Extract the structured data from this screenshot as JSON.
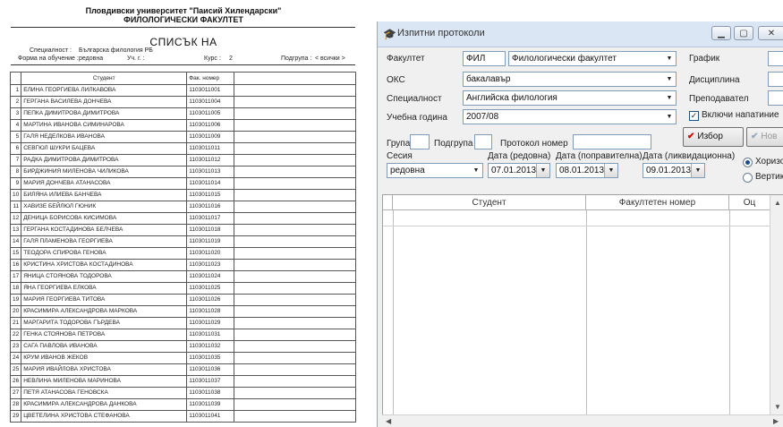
{
  "document": {
    "university": "Пловдивски университет \"Паисий Хилендарски\"",
    "faculty": "ФИЛОЛОГИЧЕСКИ ФАКУЛТЕТ",
    "title": "СПИСЪК НА",
    "specialty_label": "Специалност :",
    "specialty_value": "Българска филология РБ",
    "study_form_label": "Форма на обучение :",
    "study_form_value": "редовна",
    "year_label": "Уч. г. :",
    "course_label": "Курс :",
    "course_value": "2",
    "subgroup_label": "Подгрупа :",
    "subgroup_value": "< всички >",
    "col_student": "Студент",
    "col_fac_no": "Фак. номер",
    "rows": [
      {
        "no": "1",
        "name": "ЕЛИНА ГЕОРГИЕВА ЛИЛКАВОВА",
        "fac": "1103011001"
      },
      {
        "no": "2",
        "name": "ГЕРГАНА ВАСИЛЕВА ДОНЧЕВА",
        "fac": "1103011004"
      },
      {
        "no": "3",
        "name": "ПЕПКА ДИМИТРОВА ДИМИТРОВА",
        "fac": "1103011005"
      },
      {
        "no": "4",
        "name": "МАРТИНА ИВАНОВА СИМИНАРОВА",
        "fac": "1103011006"
      },
      {
        "no": "5",
        "name": "ГАЛЯ НЕДЕЛКОВА ИВАНОВА",
        "fac": "1103011009"
      },
      {
        "no": "6",
        "name": "СЕВГЮЛ ШУКРИ БАЦЕВА",
        "fac": "1103011011"
      },
      {
        "no": "7",
        "name": "РАДКА ДИМИТРОВА ДИМИТРОВА",
        "fac": "1103011012"
      },
      {
        "no": "8",
        "name": "БИРДЖИНИЯ МИЛЕНОВА ЧИЛИКОВА",
        "fac": "1103011013"
      },
      {
        "no": "9",
        "name": "МАРИЯ ДОНЧЕВА АТАНАСОВА",
        "fac": "1103011014"
      },
      {
        "no": "10",
        "name": "БИЛЯНА ИЛИЕВА БАНЧЕВА",
        "fac": "1103011015"
      },
      {
        "no": "11",
        "name": "ХАВИЗЕ БЕЙЛЮЛ ГЮНИК",
        "fac": "1103011016"
      },
      {
        "no": "12",
        "name": "ДЕНИЦА БОРИСОВА КИСИМОВА",
        "fac": "1103011017"
      },
      {
        "no": "13",
        "name": "ГЕРГАНА КОСТАДИНОВА БЕЛЧЕВА",
        "fac": "1103011018"
      },
      {
        "no": "14",
        "name": "ГАЛЯ ПЛАМЕНОВА ГЕОРГИЕВА",
        "fac": "1103011019"
      },
      {
        "no": "15",
        "name": "ТЕОДОРА СПИРОВА ГЕНОВА",
        "fac": "1103011020"
      },
      {
        "no": "16",
        "name": "КРИСТИНА ХРИСТОВА КОСТАДИНОВА",
        "fac": "1103011023"
      },
      {
        "no": "17",
        "name": "ЯНИЦА СТОЯНОВА ТОДОРОВА",
        "fac": "1103011024"
      },
      {
        "no": "18",
        "name": "ЯНА ГЕОРГИЕВА ЕЛКОВА",
        "fac": "1103011025"
      },
      {
        "no": "19",
        "name": "МАРИЯ ГЕОРГИЕВА ТИТОВА",
        "fac": "1103011026"
      },
      {
        "no": "20",
        "name": "КРАСИМИРА АЛЕКСАНДРОВА МАРКОВА",
        "fac": "1103011028"
      },
      {
        "no": "21",
        "name": "МАРГАРИТА ТОДОРОВА ГЪРДЕВА",
        "fac": "1103011029"
      },
      {
        "no": "22",
        "name": "ГЕНКА СТОЯНОВА ПЕТРОВА",
        "fac": "1103011031"
      },
      {
        "no": "23",
        "name": "САГА ПАВЛОВА ИВАНОВА",
        "fac": "1103011032"
      },
      {
        "no": "24",
        "name": "КРУМ ИВАНОВ ЖЕКОВ",
        "fac": "1103011035"
      },
      {
        "no": "25",
        "name": "МАРИЯ ИВАЙЛОВА ХРИСТОВА",
        "fac": "1103011036"
      },
      {
        "no": "26",
        "name": "НЕВЛИНА МИЛЕНОВА МАРИНОВА",
        "fac": "1103011037"
      },
      {
        "no": "27",
        "name": "ПЕТЯ АТАНАСОВА ГЕНОВСКА",
        "fac": "1103011038"
      },
      {
        "no": "28",
        "name": "КРАСИМИРА АЛЕКСАНДРОВА ДАНКОВА",
        "fac": "1103011039"
      },
      {
        "no": "29",
        "name": "ЦВЕТЕЛИНА ХРИСТОВА СТЕФАНОВА",
        "fac": "1103011041"
      }
    ]
  },
  "window": {
    "title": "Изпитни протоколи",
    "controls": {
      "minimize": "▁",
      "maximize": "▢",
      "close": "✕"
    },
    "form": {
      "faculty_label": "Факултет",
      "faculty_code": "ФИЛ",
      "faculty_name": "Филологически факултет",
      "oks_label": "ОКС",
      "oks_value": "бакалавър",
      "specialty_label": "Специалност",
      "specialty_value": "Английска филология",
      "year_label": "Учебна година",
      "year_value": "2007/08",
      "schedule_label": "График",
      "discipline_label": "Дисциплина",
      "teacher_label": "Преподавател",
      "include_label": "Включи напатиние",
      "include_checked": true,
      "group_label": "Група",
      "subgroup_label": "Подгрупа",
      "protocol_label": "Протокол номер",
      "select_button": "Избор",
      "new_button": "Нов",
      "session_label": "Сесия",
      "session_value": "редовна",
      "date_regular_label": "Дата (редовна)",
      "date_regular_value": "07.01.2013",
      "date_correction_label": "Дата (поправителна)",
      "date_correction_value": "08.01.2013",
      "date_liquidation_label": "Дата (ликвидационна)",
      "date_liquidation_value": "09.01.2013",
      "radio_horizontal": "Хоризо",
      "radio_vertical": "Вертик",
      "radio_selected": "horizontal"
    },
    "grid": {
      "col_student": "Студент",
      "col_fac_no": "Факултетен номер",
      "col_grade": "Оц"
    }
  },
  "colors": {
    "accent_check": "#cc0000",
    "titlebar": "#dbe6f4"
  }
}
